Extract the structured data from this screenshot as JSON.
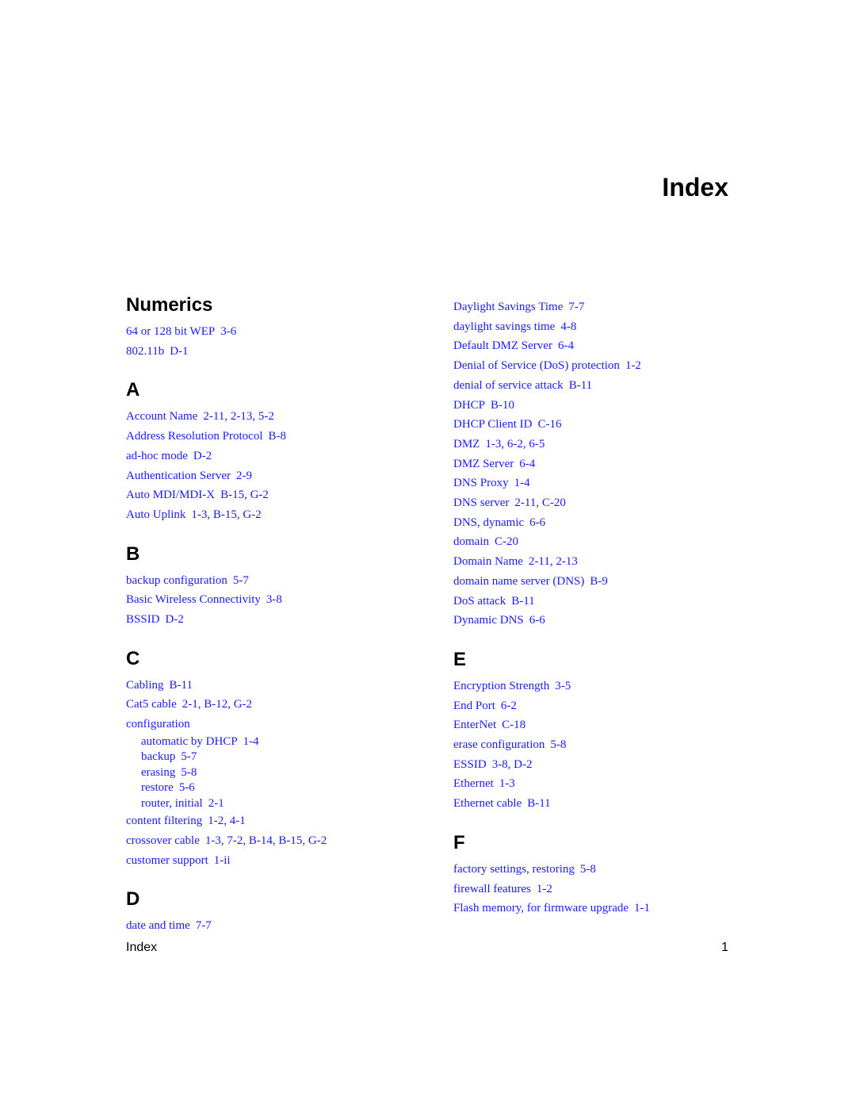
{
  "page": {
    "title": "Index",
    "footer_label": "Index",
    "page_number": "1",
    "link_color": "#1a1aff"
  },
  "left_sections": [
    {
      "heading": "Numerics",
      "entries": [
        {
          "term": "64 or 128 bit WEP",
          "pages": "3-6"
        },
        {
          "term": "802.11b",
          "pages": "D-1"
        }
      ]
    },
    {
      "heading": "A",
      "entries": [
        {
          "term": "Account Name",
          "pages": "2-11, 2-13, 5-2"
        },
        {
          "term": "Address Resolution Protocol",
          "pages": "B-8"
        },
        {
          "term": "ad-hoc mode",
          "pages": "D-2"
        },
        {
          "term": "Authentication Server",
          "pages": "2-9"
        },
        {
          "term": "Auto MDI/MDI-X",
          "pages": "B-15, G-2"
        },
        {
          "term": "Auto Uplink",
          "pages": "1-3, B-15, G-2"
        }
      ]
    },
    {
      "heading": "B",
      "entries": [
        {
          "term": "backup configuration",
          "pages": "5-7"
        },
        {
          "term": "Basic Wireless Connectivity",
          "pages": "3-8"
        },
        {
          "term": "BSSID",
          "pages": "D-2"
        }
      ]
    },
    {
      "heading": "C",
      "entries": [
        {
          "term": "Cabling",
          "pages": "B-11"
        },
        {
          "term": "Cat5 cable",
          "pages": "2-1, B-12, G-2"
        },
        {
          "term": "configuration",
          "pages": "",
          "subentries": [
            {
              "term": "automatic by DHCP",
              "pages": "1-4"
            },
            {
              "term": "backup",
              "pages": "5-7"
            },
            {
              "term": "erasing",
              "pages": "5-8"
            },
            {
              "term": "restore",
              "pages": "5-6"
            },
            {
              "term": "router, initial",
              "pages": "2-1"
            }
          ]
        },
        {
          "term": "content filtering",
          "pages": "1-2, 4-1"
        },
        {
          "term": "crossover cable",
          "pages": "1-3, 7-2, B-14, B-15, G-2"
        },
        {
          "term": "customer support",
          "pages": "1-ii"
        }
      ]
    },
    {
      "heading": "D",
      "entries": [
        {
          "term": "date and time",
          "pages": "7-7"
        }
      ]
    }
  ],
  "right_sections": [
    {
      "heading": "",
      "entries": [
        {
          "term": "Daylight Savings Time",
          "pages": "7-7"
        },
        {
          "term": "daylight savings time",
          "pages": "4-8"
        },
        {
          "term": "Default DMZ Server",
          "pages": "6-4"
        },
        {
          "term": "Denial of Service (DoS) protection",
          "pages": "1-2"
        },
        {
          "term": "denial of service attack",
          "pages": "B-11"
        },
        {
          "term": "DHCP",
          "pages": "B-10"
        },
        {
          "term": "DHCP Client ID",
          "pages": "C-16"
        },
        {
          "term": "DMZ",
          "pages": "1-3, 6-2, 6-5"
        },
        {
          "term": "DMZ Server",
          "pages": "6-4"
        },
        {
          "term": "DNS Proxy",
          "pages": "1-4"
        },
        {
          "term": "DNS server",
          "pages": "2-11, C-20"
        },
        {
          "term": "DNS, dynamic",
          "pages": "6-6"
        },
        {
          "term": "domain",
          "pages": "C-20"
        },
        {
          "term": "Domain Name",
          "pages": "2-11, 2-13"
        },
        {
          "term": "domain name server (DNS)",
          "pages": "B-9"
        },
        {
          "term": "DoS attack",
          "pages": "B-11"
        },
        {
          "term": "Dynamic DNS",
          "pages": "6-6"
        }
      ]
    },
    {
      "heading": "E",
      "entries": [
        {
          "term": "Encryption Strength",
          "pages": "3-5"
        },
        {
          "term": "End Port",
          "pages": "6-2"
        },
        {
          "term": "EnterNet",
          "pages": "C-18"
        },
        {
          "term": "erase configuration",
          "pages": "5-8"
        },
        {
          "term": "ESSID",
          "pages": "3-8, D-2"
        },
        {
          "term": "Ethernet",
          "pages": "1-3"
        },
        {
          "term": "Ethernet cable",
          "pages": "B-11"
        }
      ]
    },
    {
      "heading": "F",
      "entries": [
        {
          "term": "factory settings, restoring",
          "pages": "5-8"
        },
        {
          "term": "firewall features",
          "pages": "1-2"
        },
        {
          "term": "Flash memory, for firmware upgrade",
          "pages": "1-1"
        }
      ]
    }
  ]
}
